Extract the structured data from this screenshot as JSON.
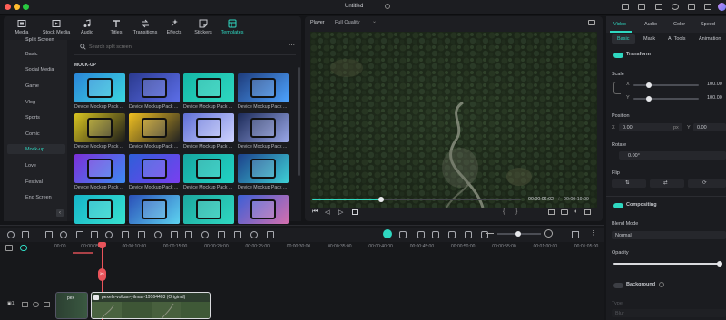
{
  "window": {
    "title": "Untitled"
  },
  "toolbar": {
    "items": [
      {
        "label": "Media",
        "icon": "media-icon"
      },
      {
        "label": "Stock Media",
        "icon": "stock-media-icon"
      },
      {
        "label": "Audio",
        "icon": "audio-icon"
      },
      {
        "label": "Titles",
        "icon": "titles-icon"
      },
      {
        "label": "Transitions",
        "icon": "transitions-icon"
      },
      {
        "label": "Effects",
        "icon": "effects-icon"
      },
      {
        "label": "Stickers",
        "icon": "stickers-icon"
      },
      {
        "label": "Templates",
        "icon": "templates-icon",
        "active": true
      }
    ]
  },
  "library": {
    "search_placeholder": "Search split screen",
    "section_label": "MOCK-UP",
    "sidebar": [
      "Split Screen",
      "Basic",
      "Social Media",
      "Game",
      "Vlog",
      "Sports",
      "Comic",
      "Mock-up",
      "Love",
      "Festival",
      "End Screen"
    ],
    "selected": "Mock-up",
    "thumbs": [
      "Device Mockup Pack ...",
      "Device Mockup Pack ...",
      "Device Mockup Pack ...",
      "Device Mockup Pack ...",
      "Device Mockup Pack ...",
      "Device Mockup Pack ...",
      "Device Mockup Pack ...",
      "Device Mockup Pack ...",
      "Device Mockup Pack ...",
      "Device Mockup Pack ...",
      "Device Mockup Pack ...",
      "Device Mockup Pack ...",
      "",
      "",
      "",
      ""
    ]
  },
  "player": {
    "tab": "Player",
    "quality": "Full Quality",
    "current_time": "00:00:06:02",
    "total_time": "00:00:19:09",
    "progress": 0.33
  },
  "props": {
    "tabs": [
      "Video",
      "Audio",
      "Color",
      "Speed"
    ],
    "active_tab": "Video",
    "subtabs": [
      "Basic",
      "Mask",
      "AI Tools",
      "Animation"
    ],
    "active_subtab": "Basic",
    "transform_label": "Transform",
    "scale_label": "Scale",
    "x_label": "X",
    "y_label": "Y",
    "scale_x": "100.00",
    "scale_y": "100.00",
    "position_label": "Position",
    "pos_x": "0.00",
    "pos_y": "0.00",
    "px_unit": "px",
    "rotate_label": "Rotate",
    "rotate_value": "0.00°",
    "flip_label": "Flip",
    "compositing_label": "Compositing",
    "blend_label": "Blend Mode",
    "blend_value": "Normal",
    "opacity_label": "Opacity",
    "background_label": "Background",
    "type_label": "Type",
    "blur_label": "Blur"
  },
  "timeline": {
    "ticks": [
      "00:00",
      "00:00:05:00",
      "00:00:10:00",
      "00:00:15:00",
      "00:00:20:00",
      "00:00:25:00",
      "00:00:30:00",
      "00:00:35:00",
      "00:00:40:00",
      "00:00:45:00",
      "00:00:50:00",
      "00:00:55:00",
      "00:01:00:00",
      "00:01:05:00"
    ],
    "clip_small": "pex",
    "clip_main": "pexels-volkan-yilmaz-19164403 (Original)",
    "track_number": "1"
  },
  "colors": {
    "accent": "#2fd8c1",
    "playhead": "#e9535a",
    "clip_border": "#d9dade"
  }
}
